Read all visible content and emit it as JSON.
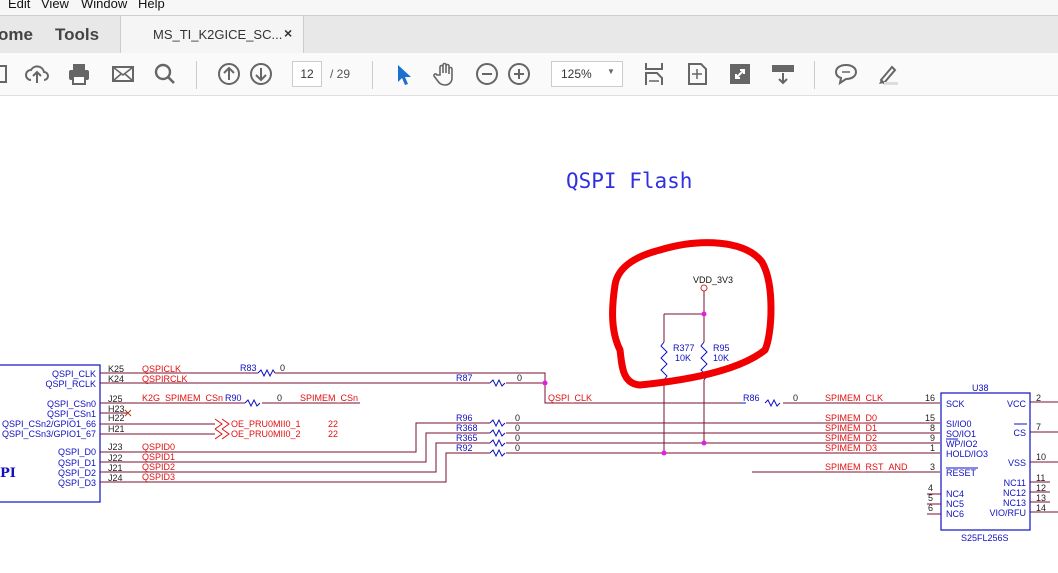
{
  "menu": [
    "Edit",
    "View",
    "Window",
    "Help"
  ],
  "tabs": {
    "home": "ome",
    "tools": "Tools",
    "document": "MS_TI_K2GICE_SC...",
    "close": "×"
  },
  "toolbar": {
    "page_current": "12",
    "page_total": "/ 29",
    "zoom": "125%",
    "icons": [
      "save-icon",
      "cloud-upload-icon",
      "print-icon",
      "email-icon",
      "search-icon",
      "page-up-icon",
      "page-down-icon",
      "select-cursor-icon",
      "hand-icon",
      "zoom-out-icon",
      "zoom-in-icon",
      "fit-width-icon",
      "fit-page-icon",
      "fullscreen-icon",
      "read-mode-icon",
      "comment-icon",
      "highlight-icon"
    ]
  },
  "schematic": {
    "title": "QSPI Flash",
    "left_part": {
      "name_fragment": "PI",
      "pins": [
        "QSPI_CLK",
        "QSPI_RCLK",
        "QSPI_CSn0",
        "QSPI_CSn1",
        "QSPI_CSn2/GPIO1_66",
        "QSPI_CSn3/GPIO1_67",
        "QSPI_D0",
        "QSPI_D1",
        "QSPI_D2",
        "QSPI_D3"
      ],
      "pin_numbers": [
        "K25",
        "K24",
        "J25",
        "H23",
        "H22",
        "H21",
        "J23",
        "J22",
        "J21",
        "J24"
      ]
    },
    "nets": {
      "qspiclk": "QSPICLK",
      "qspirclk": "QSPIRCLK",
      "k2g_cs": "K2G_SPIMEM_CSn",
      "spimem_cs": "SPIMEM_CSn",
      "oe1": "OE_PRU0MII0_1",
      "oe2": "OE_PRU0MII0_2",
      "oe_page": "22",
      "qspid": [
        "QSPID0",
        "QSPID1",
        "QSPID2",
        "QSPID3"
      ],
      "qspi_clk": "QSPI_CLK",
      "spimem_clk": "SPIMEM_CLK",
      "spimem_d": [
        "SPIMEM_D0",
        "SPIMEM_D1",
        "SPIMEM_D2",
        "SPIMEM_D3"
      ],
      "rst": "SPIMEM_RST_AND",
      "vdd": "VDD_3V3"
    },
    "resistors": {
      "r83": "R83",
      "r87": "R87",
      "r90": "R90",
      "r96": "R96",
      "r368": "R368",
      "r365": "R365",
      "r92": "R92",
      "r86": "R86",
      "r377": "R377",
      "r95": "R95",
      "zero": "0",
      "tenk": "10K"
    },
    "u38": {
      "ref": "U38",
      "part": "S25FL256S",
      "left_pins": [
        {
          "num": "16",
          "name": "SCK"
        },
        {
          "num": "15",
          "name": "SI/IO0"
        },
        {
          "num": "8",
          "name": "SO/IO1"
        },
        {
          "num": "9",
          "name": "WP/IO2"
        },
        {
          "num": "1",
          "name": "HOLD/IO3"
        },
        {
          "num": "3",
          "name": "RESET"
        },
        {
          "num": "4",
          "name": "NC4"
        },
        {
          "num": "5",
          "name": "NC5"
        },
        {
          "num": "6",
          "name": "NC6"
        }
      ],
      "right_pins": [
        {
          "num": "2",
          "name": "VCC"
        },
        {
          "num": "7",
          "name": "CS"
        },
        {
          "num": "10",
          "name": "VSS"
        },
        {
          "num": "11",
          "name": "NC11"
        },
        {
          "num": "12",
          "name": "NC12"
        },
        {
          "num": "13",
          "name": "NC13"
        },
        {
          "num": "14",
          "name": "VIO/RFU"
        }
      ]
    }
  },
  "colors": {
    "wire": "#7a1030",
    "net_label": "#e01010",
    "part": "#1010c0",
    "junction": "#e020e0",
    "annotation": "#f00000"
  }
}
